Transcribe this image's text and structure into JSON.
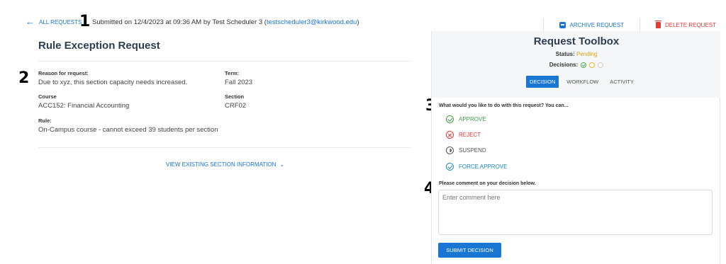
{
  "header": {
    "back_label": "ALL REQUESTS",
    "submitted_prefix": "Submitted on 12/4/2023 at 09:36 AM by Test Scheduler 3 (",
    "submitted_email": "testscheduler3@kirkwood.edu",
    "submitted_suffix": ")",
    "archive_label": "ARCHIVE REQUEST",
    "delete_label": "DELETE REQUEST"
  },
  "markers": [
    "1",
    "2",
    "3",
    "4"
  ],
  "request": {
    "title": "Rule Exception Request",
    "reason_label": "Reason for request:",
    "reason_value": "Due to xyz, this section capacity needs increased.",
    "term_label": "Term:",
    "term_value": "Fall 2023",
    "course_label": "Course",
    "course_value": "ACC152: Financial Accounting",
    "section_label": "Section",
    "section_value": "CRF02",
    "rule_label": "Rule:",
    "rule_value": "On-Campus course - cannot exceed 39 students per section",
    "view_existing_label": "VIEW EXISTING SECTION INFORMATION"
  },
  "toolbox": {
    "title": "Request Toolbox",
    "status_label": "Status:",
    "status_value": "Pending",
    "decisions_label": "Decisions:",
    "tabs": [
      "DECISION",
      "WORKFLOW",
      "ACTIVITY"
    ],
    "question": "What would you like to do with this request? You can...",
    "options": [
      "APPROVE",
      "REJECT",
      "SUSPEND",
      "FORCE APPROVE"
    ],
    "comment_label": "Please comment on your decision below.",
    "comment_placeholder": "Enter comment here",
    "submit_label": "SUBMIT DECISION"
  },
  "colors": {
    "accent": "#1976d2",
    "pending": "#e0a216",
    "approve": "#43a047",
    "reject": "#e53935",
    "force": "#1e88c8"
  }
}
